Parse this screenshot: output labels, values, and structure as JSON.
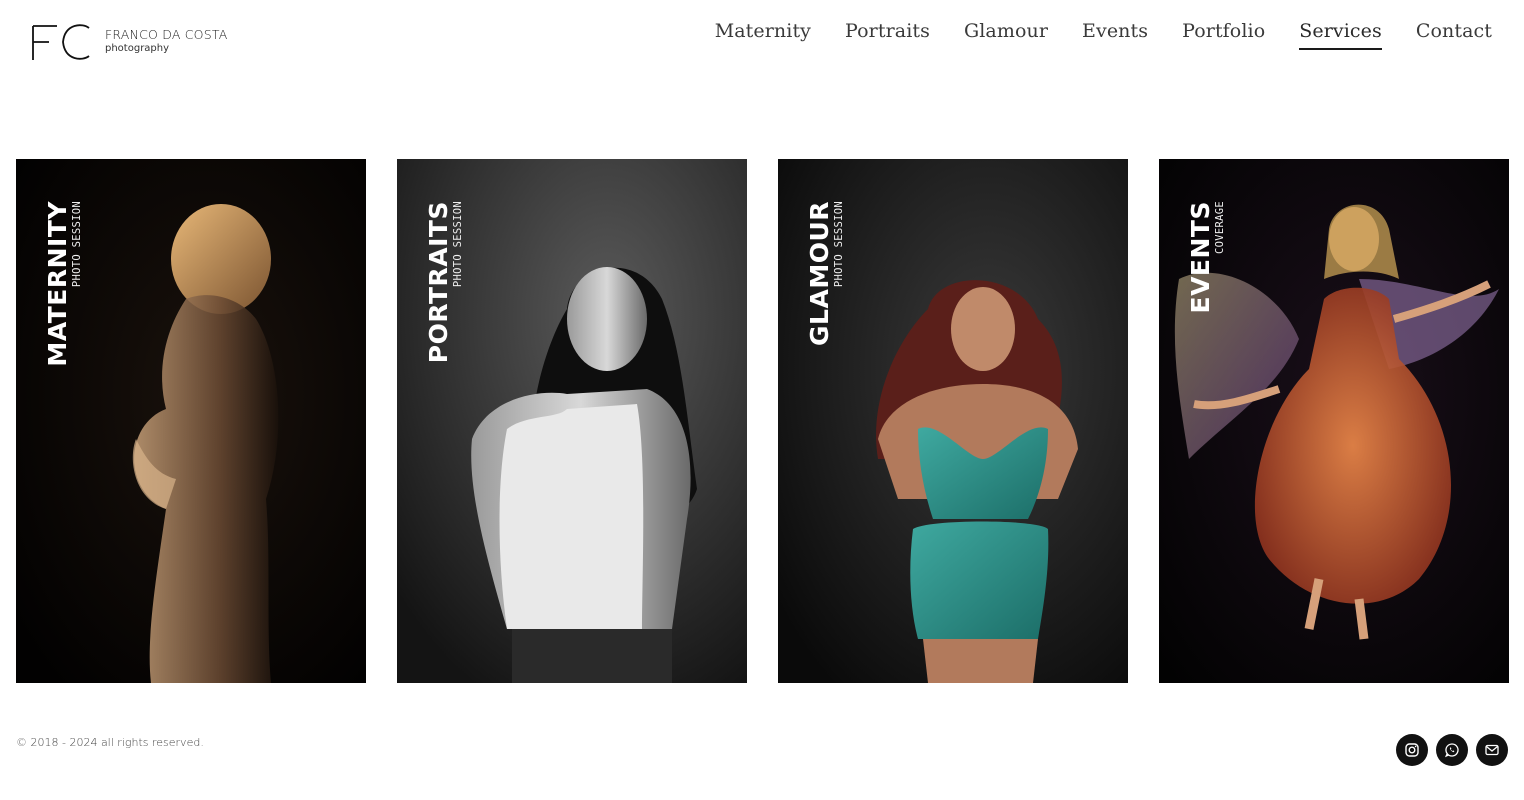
{
  "brand": {
    "mark": "FC",
    "name": "FRANCO DA COSTA",
    "subtitle": "photography"
  },
  "nav": {
    "items": [
      {
        "label": "Maternity",
        "active": false
      },
      {
        "label": "Portraits",
        "active": false
      },
      {
        "label": "Glamour",
        "active": false
      },
      {
        "label": "Events",
        "active": false
      },
      {
        "label": "Portfolio",
        "active": false
      },
      {
        "label": "Services",
        "active": true
      },
      {
        "label": "Contact",
        "active": false
      }
    ]
  },
  "cards": [
    {
      "title": "MATERNITY",
      "subtitle": "PHOTO SESSION",
      "photo": "maternity-photo"
    },
    {
      "title": "PORTRAITS",
      "subtitle": "PHOTO SESSION",
      "photo": "portraits-photo"
    },
    {
      "title": "GLAMOUR",
      "subtitle": "PHOTO SESSION",
      "photo": "glamour-photo"
    },
    {
      "title": "EVENTS",
      "subtitle": "COVERAGE",
      "photo": "events-photo"
    }
  ],
  "footer": {
    "copyright": "© 2018 - 2024 all rights reserved.",
    "socials": [
      {
        "icon": "instagram-icon"
      },
      {
        "icon": "whatsapp-icon"
      },
      {
        "icon": "email-icon"
      }
    ]
  }
}
